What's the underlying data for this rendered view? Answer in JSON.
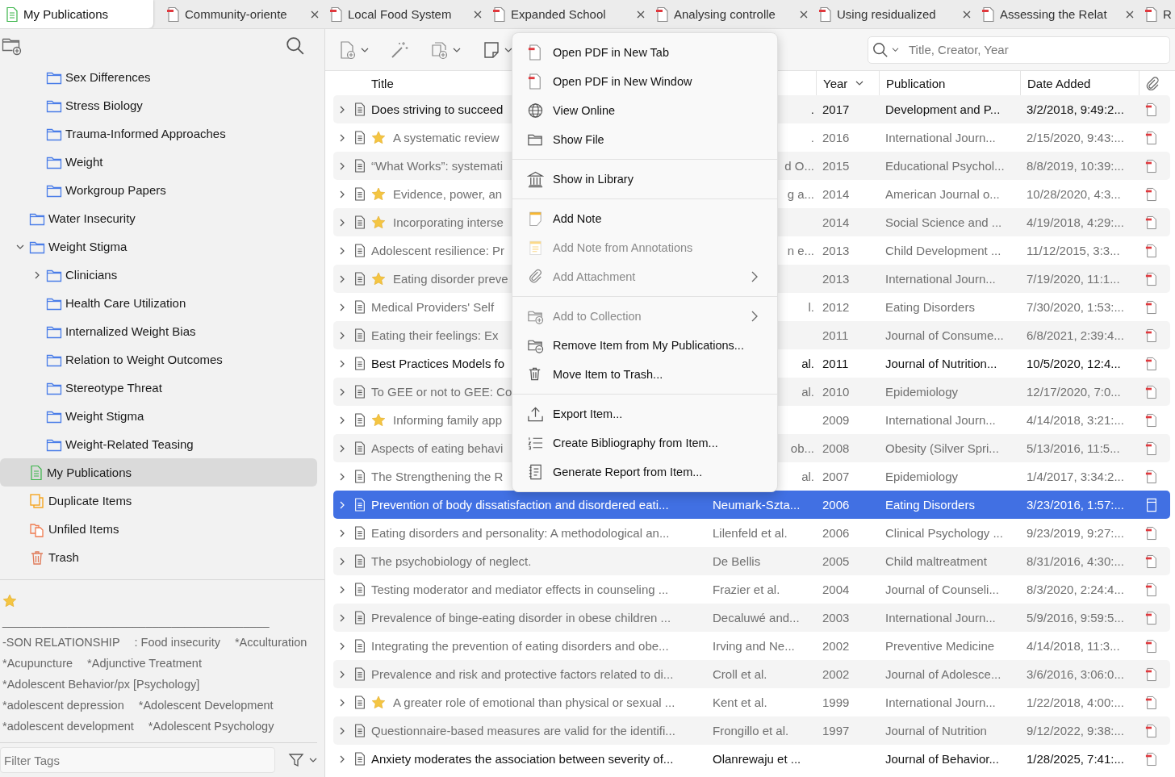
{
  "tabs": [
    {
      "label": "My Publications",
      "kind": "library",
      "selected": true,
      "closable": false
    },
    {
      "label": "Community-oriente",
      "kind": "pdf",
      "selected": false,
      "closable": true
    },
    {
      "label": "Local Food System",
      "kind": "pdf",
      "selected": false,
      "closable": true
    },
    {
      "label": "Expanded School",
      "kind": "pdf",
      "selected": false,
      "closable": true
    },
    {
      "label": "Analysing controlle",
      "kind": "pdf",
      "selected": false,
      "closable": true
    },
    {
      "label": "Using residualized",
      "kind": "pdf",
      "selected": false,
      "closable": true
    },
    {
      "label": "Assessing the Relat",
      "kind": "pdf",
      "selected": false,
      "closable": true
    },
    {
      "label": "R",
      "kind": "pdf",
      "selected": false
    }
  ],
  "collections": [
    {
      "children": [
        {
          "label": "Sex Differences",
          "kind": "folder",
          "selected": false
        },
        {
          "label": "Stress Biology",
          "kind": "folder",
          "selected": false
        },
        {
          "label": "Trauma-Informed Approaches",
          "kind": "folder",
          "selected": false
        },
        {
          "label": "Weight",
          "kind": "folder",
          "selected": false
        },
        {
          "label": "Workgroup Papers",
          "kind": "folder",
          "selected": false
        }
      ]
    },
    {
      "label": "Water Insecurity",
      "kind": "folder",
      "selected": false
    },
    {
      "label": "Weight Stigma",
      "kind": "folder",
      "selected": false,
      "expanded": true,
      "children": [
        {
          "label": "Clinicians",
          "kind": "folder",
          "selected": false,
          "expanded": false
        },
        {
          "label": "Health Care Utilization",
          "kind": "folder",
          "selected": false
        },
        {
          "label": "Internalized Weight Bias",
          "kind": "folder",
          "selected": false
        },
        {
          "label": "Relation to Weight Outcomes",
          "kind": "folder",
          "selected": false
        },
        {
          "label": "Stereotype Threat",
          "kind": "folder",
          "selected": false
        },
        {
          "label": "Weight Stigma",
          "kind": "folder",
          "selected": false
        },
        {
          "label": "Weight-Related Teasing",
          "kind": "folder",
          "selected": false
        }
      ]
    },
    {
      "label": "My Publications",
      "kind": "publications",
      "selected": true
    },
    {
      "label": "Duplicate Items",
      "kind": "duplicates",
      "selected": false
    },
    {
      "label": "Unfiled Items",
      "kind": "unfiled",
      "selected": false
    },
    {
      "label": "Trash",
      "kind": "trash",
      "selected": false
    }
  ],
  "tags": {
    "lines": [
      [
        "_________________________________________"
      ],
      [
        "-SON RELATIONSHIP",
        ": Food insecurity",
        "*Acculturation"
      ],
      [
        "*Acupuncture",
        "*Adjunctive Treatment"
      ],
      [
        "*Adolescent Behavior/px [Psychology]"
      ],
      [
        "*adolescent depression",
        "*Adolescent Development"
      ],
      [
        "*adolescent development",
        "*Adolescent Psychology"
      ]
    ],
    "filter": {
      "placeholder": "Filter Tags"
    }
  },
  "search": {
    "placeholder": "Title, Creator, Year"
  },
  "table": {
    "columns": [
      {
        "label": "Title",
        "sorted": false
      },
      {
        "label": "Year",
        "sorted": true
      },
      {
        "label": "Publication",
        "sorted": false
      },
      {
        "label": "Date Added",
        "sorted": false
      }
    ],
    "rows": [
      {
        "title": "Does striving to succeed",
        "creator": ".",
        "covered": true,
        "year": "2017",
        "publication": "Development and P...",
        "date_added": "3/2/2018, 9:49:2...",
        "starred": false,
        "faded": false,
        "selected": false
      },
      {
        "title": "A systematic review",
        "creator": ".",
        "covered": true,
        "year": "2016",
        "publication": "International Journ...",
        "date_added": "2/15/2020, 9:43:...",
        "starred": true,
        "faded": true,
        "selected": false
      },
      {
        "title": "“What Works”: systemati",
        "creator": "d O...",
        "covered": true,
        "year": "2015",
        "publication": "Educational Psychol...",
        "date_added": "8/8/2019, 10:39:...",
        "starred": false,
        "faded": true,
        "selected": false
      },
      {
        "title": "Evidence, power, an",
        "creator": "g a...",
        "covered": true,
        "year": "2014",
        "publication": "American Journal o...",
        "date_added": "10/28/2020, 4:3...",
        "starred": true,
        "faded": true,
        "selected": false
      },
      {
        "title": "Incorporating interse",
        "covered": true,
        "year": "2014",
        "publication": "Social Science and ...",
        "date_added": "4/19/2018, 4:29:...",
        "starred": true,
        "faded": true,
        "selected": false
      },
      {
        "title": "Adolescent resilience: Pr",
        "creator": "n e...",
        "covered": true,
        "year": "2013",
        "publication": "Child Development ...",
        "date_added": "11/12/2015, 3:3...",
        "starred": false,
        "faded": true,
        "selected": false
      },
      {
        "title": "Eating disorder preve",
        "covered": true,
        "year": "2013",
        "publication": "International Journ...",
        "date_added": "7/19/2020, 11:1...",
        "starred": true,
        "faded": true,
        "selected": false
      },
      {
        "title": "Medical Providers' Self",
        "creator": "l.",
        "covered": true,
        "year": "2012",
        "publication": "Eating Disorders",
        "date_added": "7/30/2020, 1:53:...",
        "starred": false,
        "faded": true,
        "selected": false
      },
      {
        "title": "Eating their feelings: Ex",
        "covered": true,
        "year": "2011",
        "publication": "Journal of Consume...",
        "date_added": "6/8/2021, 2:39:4...",
        "starred": false,
        "faded": true,
        "selected": false
      },
      {
        "title": "Best Practices Models fo",
        "creator": "al.",
        "covered": true,
        "year": "2011",
        "publication": "Journal of Nutrition...",
        "date_added": "10/5/2020, 12:4...",
        "starred": false,
        "faded": false,
        "selected": false
      },
      {
        "title": "To GEE or not to GEE: Co",
        "creator": "al.",
        "covered": true,
        "year": "2010",
        "publication": "Epidemiology",
        "date_added": "12/17/2020, 7:0...",
        "starred": false,
        "faded": true,
        "selected": false
      },
      {
        "title": "Informing family app",
        "covered": true,
        "year": "2009",
        "publication": "International Journ...",
        "date_added": "4/14/2018, 3:21:...",
        "starred": true,
        "faded": true,
        "selected": false
      },
      {
        "title": "Aspects of eating behavi",
        "creator": "ob...",
        "covered": true,
        "year": "2008",
        "publication": "Obesity (Silver Spri...",
        "date_added": "5/13/2016, 11:5...",
        "starred": false,
        "faded": true,
        "selected": false
      },
      {
        "title": "The Strengthening the R",
        "creator": "al.",
        "covered": true,
        "year": "2007",
        "publication": "Epidemiology",
        "date_added": "1/4/2017, 3:34:2...",
        "starred": false,
        "faded": true,
        "selected": false
      },
      {
        "title": "Prevention of body dissatisfaction and disordered eati...",
        "creator": "Neumark-Szta...",
        "covered": false,
        "year": "2006",
        "publication": "Eating Disorders",
        "date_added": "3/23/2016, 1:57:...",
        "starred": false,
        "faded": true,
        "selected": true
      },
      {
        "title": "Eating disorders and personality: A methodological an...",
        "creator": "Lilenfeld et al.",
        "covered": false,
        "year": "2006",
        "publication": "Clinical Psychology ...",
        "date_added": "9/23/2019, 9:27:...",
        "starred": false,
        "faded": true,
        "selected": false
      },
      {
        "title": "The psychobiology of neglect.",
        "creator": "De Bellis",
        "covered": false,
        "year": "2005",
        "publication": "Child maltreatment",
        "date_added": "8/31/2016, 4:30:...",
        "starred": false,
        "faded": true,
        "selected": false
      },
      {
        "title": "Testing moderator and mediator effects in counseling ...",
        "creator": "Frazier et al.",
        "covered": false,
        "year": "2004",
        "publication": "Journal of Counseli...",
        "date_added": "8/3/2020, 2:24:4...",
        "starred": false,
        "faded": true,
        "selected": false
      },
      {
        "title": "Prevalence of binge-eating disorder in obese children ...",
        "creator": "Decaluwé and...",
        "covered": false,
        "year": "2003",
        "publication": "International Journ...",
        "date_added": "5/9/2016, 9:59:5...",
        "starred": false,
        "faded": true,
        "selected": false
      },
      {
        "title": "Integrating the prevention of eating disorders and obe...",
        "creator": "Irving and Ne...",
        "covered": false,
        "year": "2002",
        "publication": "Preventive Medicine",
        "date_added": "4/14/2018, 11:3...",
        "starred": false,
        "faded": true,
        "selected": false
      },
      {
        "title": "Prevalence and risk and protective factors related to di...",
        "creator": "Croll et al.",
        "covered": false,
        "year": "2002",
        "publication": "Journal of Adolesce...",
        "date_added": "3/6/2016, 3:06:0...",
        "starred": false,
        "faded": true,
        "selected": false
      },
      {
        "title": "A greater role of emotional than physical or sexual ...",
        "creator": "Kent et al.",
        "covered": false,
        "year": "1999",
        "publication": "International Journ...",
        "date_added": "1/22/2018, 4:00:...",
        "starred": true,
        "faded": true,
        "selected": false
      },
      {
        "title": "Questionnaire-based measures are valid for the identifi...",
        "creator": "Frongillo et al.",
        "covered": false,
        "year": "1997",
        "publication": "Journal of Nutrition",
        "date_added": "9/12/2022, 9:38:...",
        "starred": false,
        "faded": true,
        "selected": false
      },
      {
        "title": "Anxiety moderates the association between severity of...",
        "creator": "Olanrewaju et ...",
        "covered": false,
        "publication": "Journal of Behavior...",
        "date_added": "1/28/2025, 7:41:...",
        "starred": false,
        "faded": false,
        "selected": false
      }
    ]
  },
  "context_menu": {
    "groups": [
      {
        "items": [
          {
            "label": "Open PDF in New Tab",
            "disabled": false,
            "submenu": false
          },
          {
            "label": "Open PDF in New Window",
            "disabled": false,
            "submenu": false
          },
          {
            "label": "View Online",
            "disabled": false,
            "submenu": false
          },
          {
            "label": "Show File",
            "disabled": false,
            "submenu": false
          }
        ]
      },
      {
        "items": [
          {
            "label": "Show in Library",
            "disabled": false,
            "submenu": false
          }
        ]
      },
      {
        "items": [
          {
            "label": "Add Note",
            "disabled": false,
            "submenu": false
          },
          {
            "label": "Add Note from Annotations",
            "disabled": true,
            "submenu": false
          },
          {
            "label": "Add Attachment",
            "disabled": true,
            "submenu": true
          }
        ]
      },
      {
        "items": [
          {
            "label": "Add to Collection",
            "disabled": true,
            "submenu": true
          },
          {
            "label": "Remove Item from My Publications...",
            "disabled": false,
            "submenu": false
          },
          {
            "label": "Move Item to Trash...",
            "disabled": false,
            "submenu": false
          }
        ]
      },
      {
        "items": [
          {
            "label": "Export Item...",
            "disabled": false,
            "submenu": false
          },
          {
            "label": "Create Bibliography from Item...",
            "disabled": false,
            "submenu": false
          },
          {
            "label": "Generate Report from Item...",
            "disabled": false,
            "submenu": false
          }
        ]
      }
    ]
  }
}
